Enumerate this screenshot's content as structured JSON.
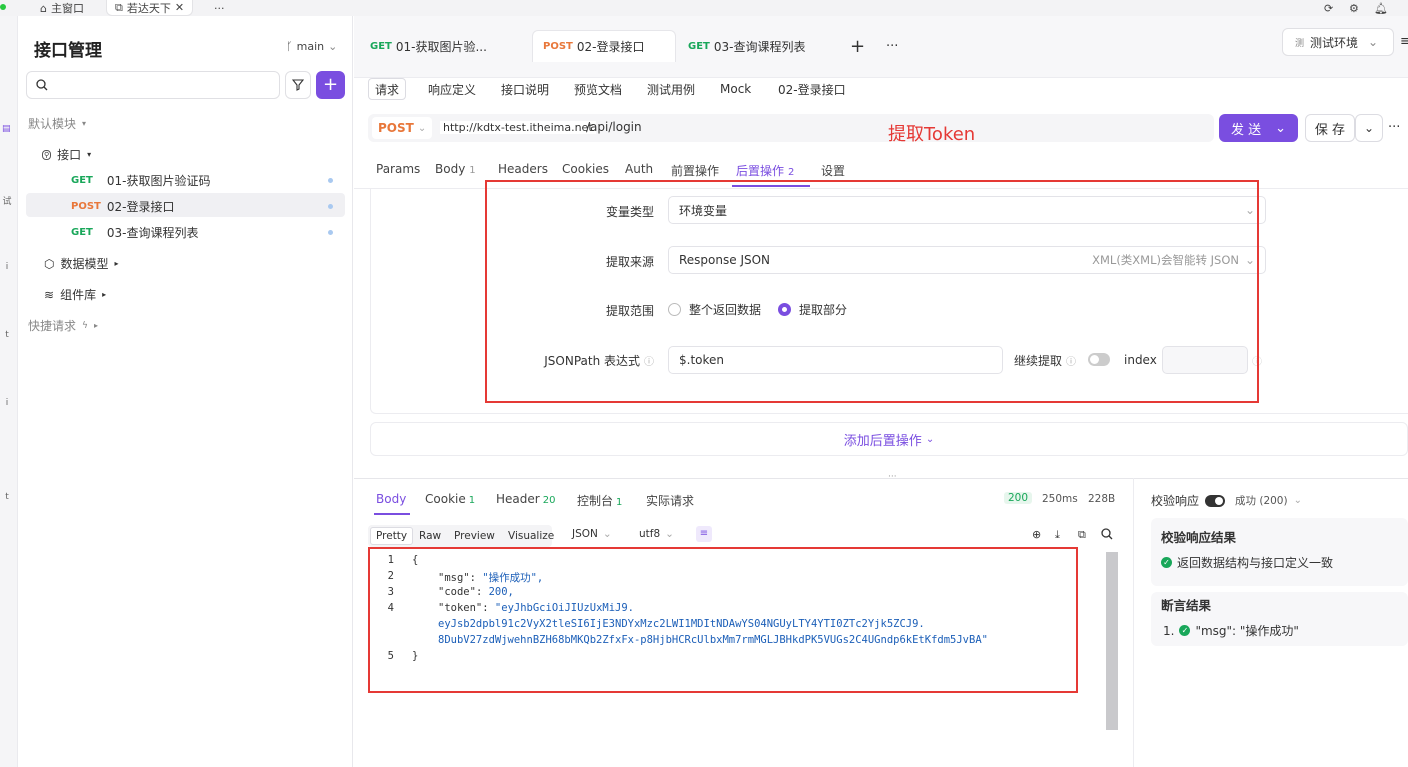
{
  "topbar": {
    "home_tab": "主窗口",
    "project_tab": "若达天下",
    "more": "···"
  },
  "rail": {
    "labels": [
      "试",
      "i",
      "t",
      "i",
      "t"
    ]
  },
  "sidebar": {
    "title": "接口管理",
    "branch": "main",
    "search_placeholder": "",
    "default_module": "默认模块",
    "api_folder": "接口",
    "items": [
      {
        "method": "GET",
        "name": "01-获取图片验证码"
      },
      {
        "method": "POST",
        "name": "02-登录接口"
      },
      {
        "method": "GET",
        "name": "03-查询课程列表"
      }
    ],
    "data_model": "数据模型",
    "component_lib": "组件库",
    "quick_request": "快捷请求"
  },
  "tabs": [
    {
      "method": "GET",
      "name": "01-获取图片验..."
    },
    {
      "method": "POST",
      "name": "02-登录接口"
    },
    {
      "method": "GET",
      "name": "03-查询课程列表"
    }
  ],
  "env": "测试环境",
  "env_badge": "测",
  "subtabs": [
    "请求",
    "响应定义",
    "接口说明",
    "预览文档",
    "测试用例",
    "Mock"
  ],
  "subtab_title": "02-登录接口",
  "url": {
    "method": "POST",
    "base": "http://kdtx-test.itheima.net",
    "path": "/api/login"
  },
  "send_label": "发 送",
  "save_label": "保 存",
  "annotation": "提取Token",
  "param_tabs": [
    {
      "label": "Params",
      "count": ""
    },
    {
      "label": "Body",
      "count": "1"
    },
    {
      "label": "Headers",
      "count": ""
    },
    {
      "label": "Cookies",
      "count": ""
    },
    {
      "label": "Auth",
      "count": ""
    },
    {
      "label": "前置操作",
      "count": ""
    },
    {
      "label": "后置操作",
      "count": "2"
    },
    {
      "label": "设置",
      "count": ""
    }
  ],
  "extract": {
    "var_type_label": "变量类型",
    "var_type_value": "环境变量",
    "source_label": "提取来源",
    "source_value": "Response JSON",
    "source_hint": "XML(类XML)会智能转 JSON",
    "range_label": "提取范围",
    "range_all": "整个返回数据",
    "range_part": "提取部分",
    "jsonpath_label": "JSONPath 表达式",
    "jsonpath_value": "$.token",
    "continue_label": "继续提取",
    "index_label": "index",
    "index_value": ""
  },
  "add_post_op": "添加后置操作",
  "response": {
    "tabs": [
      {
        "label": "Body",
        "count": ""
      },
      {
        "label": "Cookie",
        "count": "1"
      },
      {
        "label": "Header",
        "count": "20"
      },
      {
        "label": "控制台",
        "count": "1"
      },
      {
        "label": "实际请求",
        "count": ""
      }
    ],
    "status": "200",
    "time": "250ms",
    "size": "228B",
    "formats": [
      "Pretty",
      "Raw",
      "Preview",
      "Visualize"
    ],
    "lang": "JSON",
    "encoding": "utf8",
    "code_lines": [
      {
        "n": "1",
        "text": "{"
      },
      {
        "n": "2",
        "key": "\"msg\"",
        "val": "\"操作成功\","
      },
      {
        "n": "3",
        "key": "\"code\"",
        "val": "200,"
      },
      {
        "n": "4",
        "key": "\"token\"",
        "val": "\"eyJhbGciOiJIUzUxMiJ9."
      },
      {
        "n": "",
        "text": "eyJsb2dpbl91c2VyX2tleSI6IjE3NDYxMzc2LWI1MDItNDAwYS04NGUyLTY4YTI0ZTc2Yjk5ZCJ9."
      },
      {
        "n": "",
        "text": "8DubV27zdWjwehnBZH68bMKQb2ZfxFx-p8HjbHCRcUlbxMm7rmMGLJBHkdPK5VUGs2C4UGndp6kEtKfdm5JvBA\""
      },
      {
        "n": "5",
        "text": "}"
      }
    ]
  },
  "validation": {
    "label": "校验响应",
    "status": "成功 (200)",
    "result_title": "校验响应结果",
    "result_text": "返回数据结构与接口定义一致",
    "assert_title": "断言结果",
    "assert_item": "1.",
    "assert_text": "\"msg\": \"操作成功\""
  }
}
